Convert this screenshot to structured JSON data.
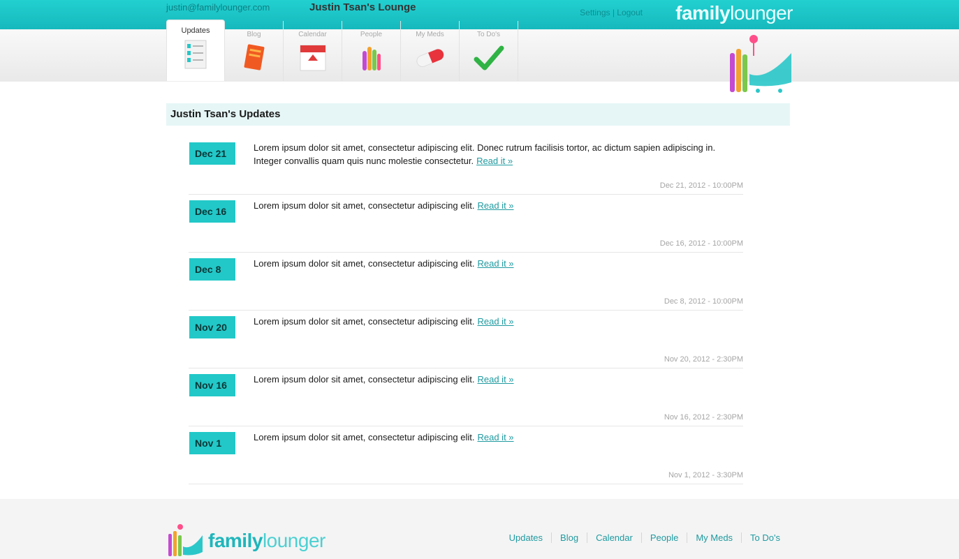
{
  "topbar": {
    "account_email": "justin@familylounger.com",
    "title": "Justin Tsan's Lounge",
    "signout": "Settings | Logout",
    "logo_bold": "family",
    "logo_light": "lounger",
    "color": "#16b9bd"
  },
  "tabs": [
    {
      "label": "Updates",
      "icon": "updates-list-icon",
      "active": true
    },
    {
      "label": "Blog",
      "icon": "blog-notebook-icon",
      "active": false
    },
    {
      "label": "Calendar",
      "icon": "calendar-icon",
      "active": false
    },
    {
      "label": "People",
      "icon": "people-icon",
      "active": false
    },
    {
      "label": "My Meds",
      "icon": "pill-icon",
      "active": false
    },
    {
      "label": "To Do's",
      "icon": "checkmark-icon",
      "active": false
    }
  ],
  "section_title": "Justin Tsan's Updates",
  "updates": [
    {
      "date": "Dec 21",
      "text": "Lorem ipsum dolor sit amet, consectetur adipiscing elit. Donec rutrum facilisis tortor, ac dictum sapien adipiscing in. Integer convallis quam quis nunc molestie consectetur.",
      "read_more": "Read it »",
      "timestamp": "Dec 21, 2012 - 10:00PM"
    },
    {
      "date": "Dec 16",
      "text": "Lorem ipsum dolor sit amet, consectetur adipiscing elit.",
      "read_more": "Read it »",
      "timestamp": "Dec 16, 2012 - 10:00PM"
    },
    {
      "date": "Dec 8",
      "text": "Lorem ipsum dolor sit amet, consectetur adipiscing elit.",
      "read_more": "Read it »",
      "timestamp": "Dec 8, 2012 - 10:00PM"
    },
    {
      "date": "Nov 20",
      "text": "Lorem ipsum dolor sit amet, consectetur adipiscing elit.",
      "read_more": "Read it »",
      "timestamp": "Nov 20, 2012 - 2:30PM"
    },
    {
      "date": "Nov 16",
      "text": "Lorem ipsum dolor sit amet, consectetur adipiscing elit.",
      "read_more": "Read it »",
      "timestamp": "Nov 16, 2012 - 2:30PM"
    },
    {
      "date": "Nov 1",
      "text": "Lorem ipsum dolor sit amet, consectetur adipiscing elit.",
      "read_more": "Read it »",
      "timestamp": "Nov 1, 2012 - 3:30PM"
    }
  ],
  "footer": {
    "logo_bold": "family",
    "logo_light": "lounger",
    "links": [
      "Updates",
      "Blog",
      "Calendar",
      "People",
      "My Meds",
      "To Do's"
    ]
  },
  "colors": {
    "accent": "#22c8c8",
    "header_band": "#e6f6f6",
    "link": "#1e9aa0"
  }
}
